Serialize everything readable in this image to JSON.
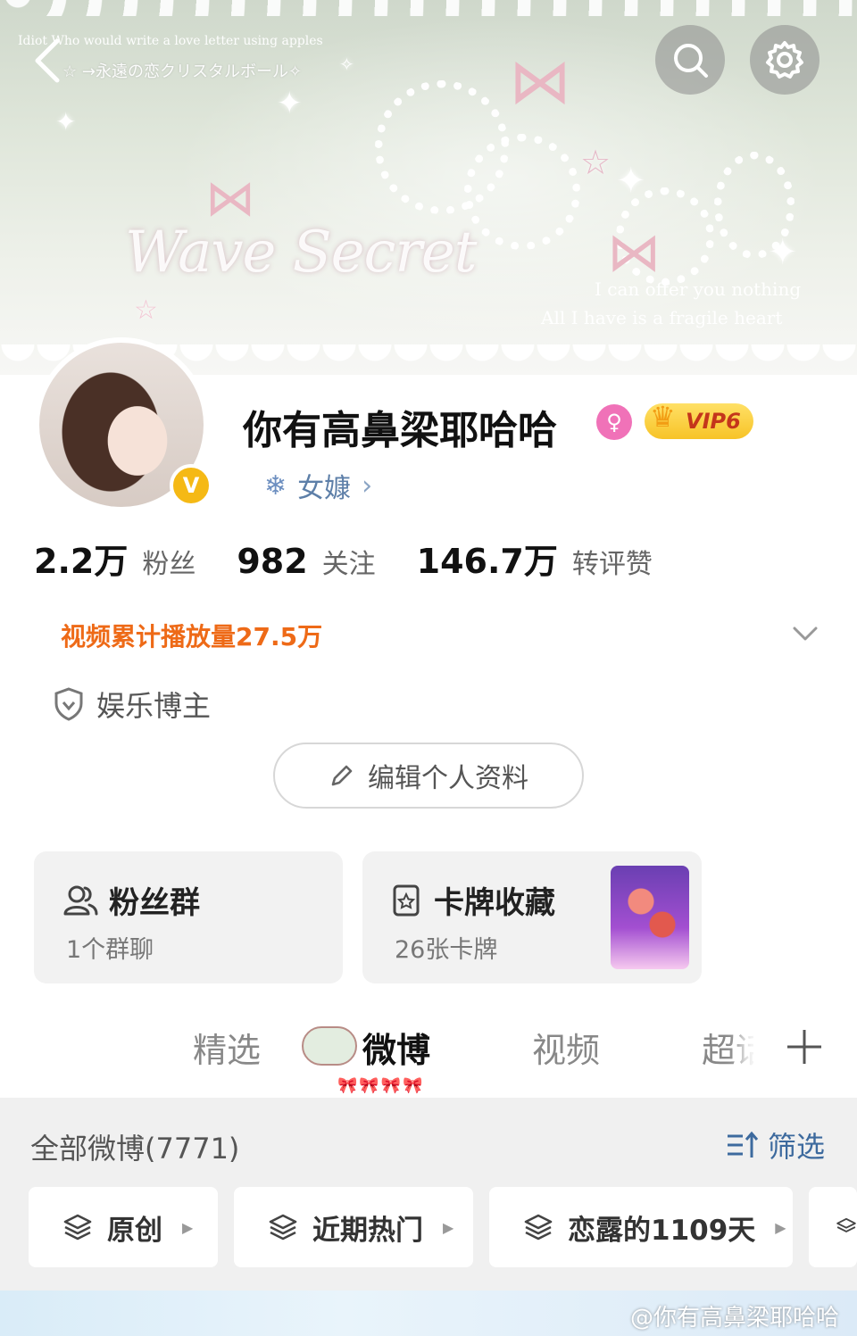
{
  "banner": {
    "line1": "Idiot Who would write a love letter using apples",
    "line2": "☆ →永遠の恋クリスタルボール✧",
    "script_text": "Wave Secret",
    "caption_right_1": "I can offer you nothing",
    "caption_right_2": "All I have is a fragile heart"
  },
  "header": {
    "search_icon": "search-icon",
    "settings_icon": "gear-icon",
    "back_icon": "back-arrow-icon"
  },
  "profile": {
    "username": "你有高鼻梁耶哈哈",
    "gender": "♀",
    "vip_label": "VIP6",
    "verify_mark": "V",
    "tag": "女嫝",
    "tag_chevron": "›",
    "stats": [
      {
        "num": "2.2万",
        "label": "粉丝"
      },
      {
        "num": "982",
        "label": "关注"
      },
      {
        "num": "146.7万",
        "label": "转评赞"
      }
    ],
    "video_plays": "视频累计播放量27.5万",
    "blogger_type": "娱乐博主",
    "edit_button": "编辑个人资料"
  },
  "cards": {
    "fans_group": {
      "title": "粉丝群",
      "sub": "1个群聊"
    },
    "card_collection": {
      "title": "卡牌收藏",
      "sub": "26张卡牌"
    }
  },
  "tabs": {
    "items": [
      "精选",
      "微博",
      "视频",
      "超话"
    ],
    "active_decoration": "🎀🎀🎀🎀"
  },
  "feed": {
    "title": "全部微博(7771)",
    "filter_label": "筛选",
    "chips": [
      "原创",
      "近期热门",
      "恋露的1109天"
    ]
  },
  "watermark": "@你有高鼻梁耶哈哈",
  "colors": {
    "accent_orange": "#ee6a17",
    "link_blue": "#3d6a9e",
    "verify_yellow": "#f5b915",
    "gender_pink": "#f072b8"
  }
}
